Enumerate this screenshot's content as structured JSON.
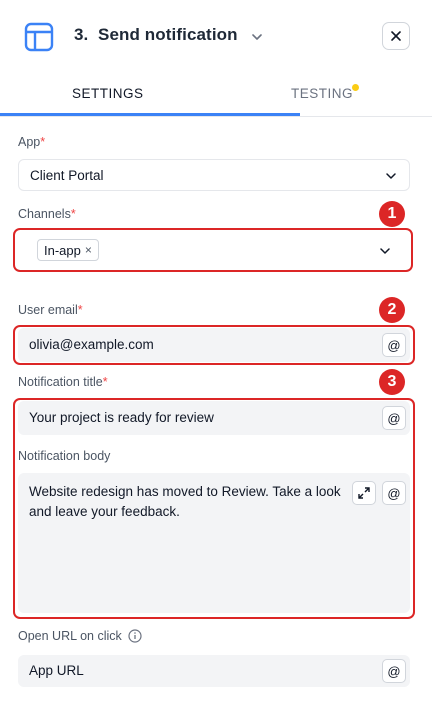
{
  "header": {
    "title": "3.  Send notification",
    "close_icon": "close-icon",
    "step_icon": "layout-panel-icon"
  },
  "tabs": [
    {
      "label": "SETTINGS",
      "active": true
    },
    {
      "label": "TESTING",
      "active": false,
      "indicator_color": "#facc15"
    }
  ],
  "form": {
    "app": {
      "label": "App",
      "required_mark": "*",
      "value": "Client Portal"
    },
    "channels": {
      "label": "Channels",
      "required_mark": "*",
      "chips": [
        "In-app"
      ],
      "chip_remove": "×"
    },
    "user_email": {
      "label": "User email",
      "required_mark": "*",
      "value": "olivia@example.com",
      "at_label": "@"
    },
    "notification_title": {
      "label": "Notification title",
      "required_mark": "*",
      "value": "Your project is ready for review",
      "at_label": "@"
    },
    "notification_body": {
      "label": "Notification body",
      "value": "Website redesign has moved to Review. Take a look and leave your feedback.",
      "at_label": "@"
    },
    "open_url": {
      "label": "Open URL on click",
      "placeholder": "App URL",
      "at_label": "@"
    }
  },
  "annotations": [
    {
      "number": "1"
    },
    {
      "number": "2"
    },
    {
      "number": "3"
    }
  ],
  "colors": {
    "accent": "#3b82f6",
    "highlight": "#dc2626",
    "required": "#ef4444",
    "field_bg": "#f3f4f6"
  }
}
